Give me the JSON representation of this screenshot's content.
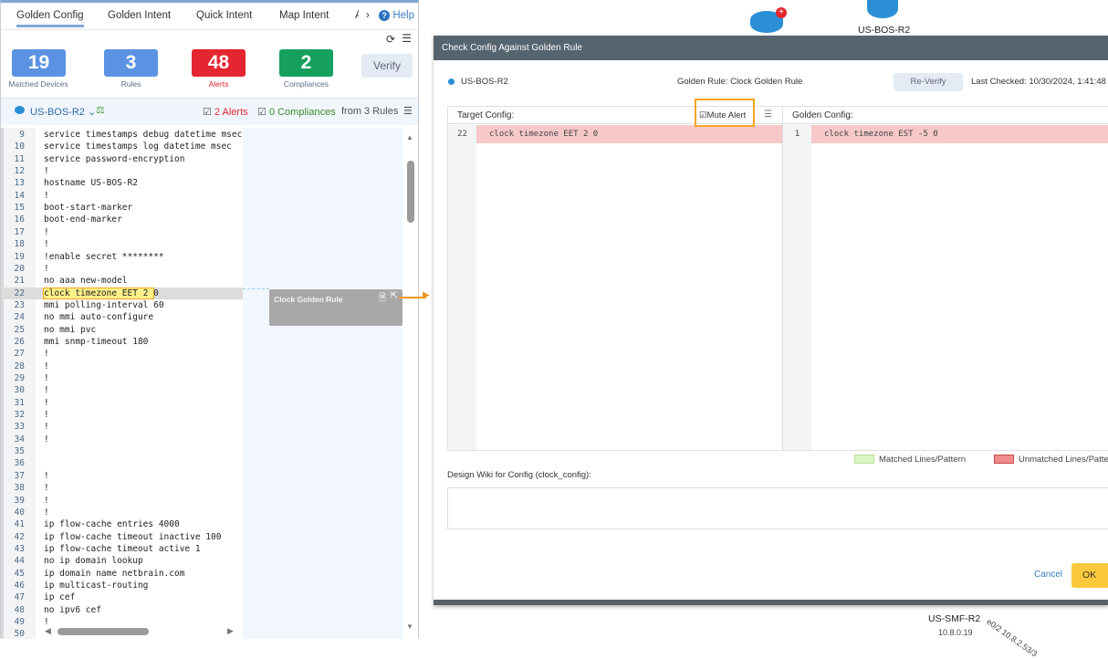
{
  "tabs": [
    "Golden Config",
    "Golden Intent",
    "Quick Intent",
    "Map Intent",
    "A"
  ],
  "help": "Help",
  "stats": [
    {
      "value": "19",
      "label": "Matched Devices",
      "color": "#5b93e2"
    },
    {
      "value": "3",
      "label": "Rules",
      "color": "#5b93e2"
    },
    {
      "value": "48",
      "label": "Alerts",
      "color": "#e3262f"
    },
    {
      "value": "2",
      "label": "Compliances",
      "color": "#16a05d"
    }
  ],
  "verify": "Verify",
  "device": "US-BOS-R2",
  "alerts": "2 Alerts",
  "compliances": "0 Compliances",
  "from_rules": "from 3 Rules",
  "code": [
    [
      "9",
      "service timestamps debug datetime msec"
    ],
    [
      "10",
      "service timestamps log datetime msec"
    ],
    [
      "11",
      "service password-encryption"
    ],
    [
      "12",
      "!"
    ],
    [
      "13",
      "hostname US-BOS-R2"
    ],
    [
      "14",
      "!"
    ],
    [
      "15",
      "boot-start-marker"
    ],
    [
      "16",
      "boot-end-marker"
    ],
    [
      "17",
      "!"
    ],
    [
      "18",
      "!"
    ],
    [
      "19",
      "!enable secret ********"
    ],
    [
      "20",
      "!"
    ],
    [
      "21",
      "no aaa new-model"
    ],
    [
      "22",
      "clock timezone EET 2 0"
    ],
    [
      "23",
      "mmi polling-interval 60"
    ],
    [
      "24",
      "no mmi auto-configure"
    ],
    [
      "25",
      "no mmi pvc"
    ],
    [
      "26",
      "mmi snmp-timeout 180"
    ],
    [
      "27",
      "!"
    ],
    [
      "28",
      "!"
    ],
    [
      "29",
      "!"
    ],
    [
      "30",
      "!"
    ],
    [
      "31",
      "!"
    ],
    [
      "32",
      "!"
    ],
    [
      "33",
      "!"
    ],
    [
      "34",
      "!"
    ],
    [
      "35",
      ""
    ],
    [
      "36",
      ""
    ],
    [
      "37",
      "!"
    ],
    [
      "38",
      "!"
    ],
    [
      "39",
      "!"
    ],
    [
      "40",
      "!"
    ],
    [
      "41",
      "ip flow-cache entries 4000"
    ],
    [
      "42",
      "ip flow-cache timeout inactive 100"
    ],
    [
      "43",
      "ip flow-cache timeout active 1"
    ],
    [
      "44",
      "no ip domain lookup"
    ],
    [
      "45",
      "ip domain name netbrain.com"
    ],
    [
      "46",
      "ip multicast-routing"
    ],
    [
      "47",
      "ip cef"
    ],
    [
      "48",
      "no ipv6 cef"
    ],
    [
      "49",
      "!"
    ],
    [
      "50",
      ""
    ]
  ],
  "rule_card": "Clock Golden Rule",
  "map": {
    "device1": "US-BOS-R2",
    "device2": "US-SMF-R2",
    "ip": "10.8.0.19",
    "link": "e0/2 10.8.2.53/3"
  },
  "dialog": {
    "title": "Check Config Against Golden Rule",
    "device": "US-BOS-R2",
    "golden_rule": "Golden Rule: Clock Golden Rule",
    "reverify": "Re-Verify",
    "last_checked": "Last Checked: 10/30/2024, 1:41:48",
    "target_label": "Target Config:",
    "mute_alert": "Mute Alert",
    "golden_label": "Golden Config:",
    "target_line_no": "22",
    "target_line": "clock timezone EET 2 0",
    "golden_line_no": "1",
    "golden_line": "clock timezone EST -5 0",
    "matched": "Matched Lines/Pattern",
    "unmatched": "Unmatched Lines/Pattern",
    "wiki_label": "Design Wiki for Config (clock_config):",
    "wiki_value": "",
    "cancel": "Cancel",
    "ok": "OK"
  }
}
